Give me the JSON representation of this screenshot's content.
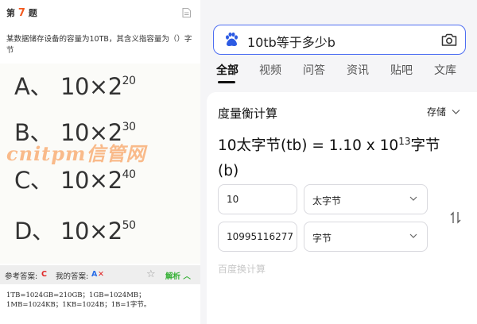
{
  "quiz": {
    "question_prefix": "第",
    "question_number": "7",
    "question_suffix": "题",
    "question_text": "某数据储存设备的容量为10TB，其含义指容量为（）字节",
    "options": [
      {
        "letter": "A、",
        "base": "10×2",
        "exp": "20"
      },
      {
        "letter": "B、",
        "base": "10×2",
        "exp": "30"
      },
      {
        "letter": "C、",
        "base": "10×2",
        "exp": "40"
      },
      {
        "letter": "D、",
        "base": "10×2",
        "exp": "50"
      }
    ],
    "watermark": "cnitpm信管网",
    "ref_answer_label": "参考答案:",
    "ref_answer": "C",
    "my_answer_label": "我的答案:",
    "my_answer": "A",
    "wrong_mark": "✕",
    "star": "☆",
    "analysis_label": "解析",
    "analysis_chevron": "︿",
    "explanation_line1": "1TB=1024GB=210GB；1GB=1024MB；",
    "explanation_line2": "1MB=1024KB；1KB=1024B；1B=1字节。"
  },
  "search": {
    "query": "10tb等于多少b",
    "tabs": [
      "全部",
      "视频",
      "问答",
      "资讯",
      "贴吧",
      "文库"
    ],
    "active_tab": 0
  },
  "converter": {
    "title": "度量衡计算",
    "save_label": "存储",
    "result_prefix": "10太字节(tb) = 1.10 x 10",
    "result_exp": "13",
    "result_suffix": "字节",
    "result_line2": "(b)",
    "input_value": "10",
    "input_unit": "太字节",
    "output_value": "10995116277",
    "output_unit": "字节",
    "footer_partial": "百度换计算"
  },
  "colors": {
    "accent_orange": "#f35a1f",
    "answer_red": "#e02828",
    "answer_blue": "#2a6ee8",
    "analysis_green": "#33b033",
    "search_border": "#4e6ef2"
  }
}
